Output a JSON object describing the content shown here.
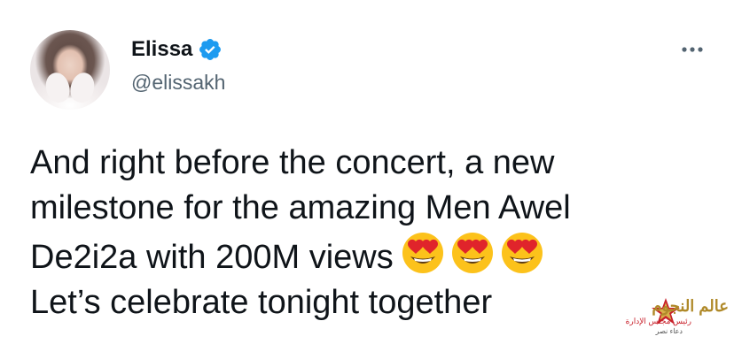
{
  "tweet": {
    "author": {
      "display_name": "Elissa",
      "handle": "@elissakh",
      "verified": true,
      "avatar_icon": "avatar-photo"
    },
    "more_icon": "more-horizontal-icon",
    "lines": [
      "And right before the concert, a new",
      "milestone for the amazing Men Awel",
      "De2i2a with 200M views",
      "Let’s celebrate tonight together"
    ],
    "emojis": [
      "smiling-face-with-heart-eyes",
      "smiling-face-with-heart-eyes",
      "smiling-face-with-heart-eyes"
    ]
  },
  "watermark": {
    "title": "عالم النجوم",
    "subtitle": "رئيس مجلس الإدارة",
    "name": "دعاء نصر"
  },
  "colors": {
    "text_primary": "#0f1419",
    "text_secondary": "#536471",
    "verified_blue": "#1d9bf0",
    "background": "#ffffff"
  }
}
